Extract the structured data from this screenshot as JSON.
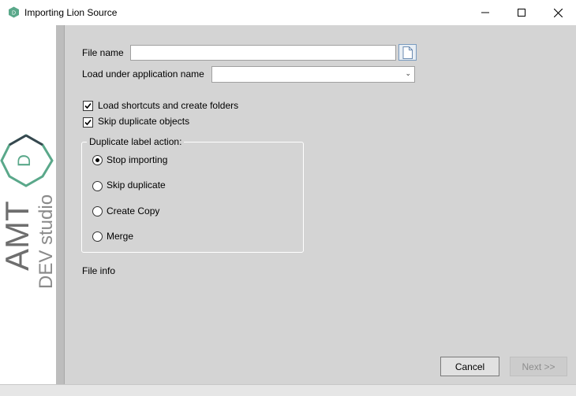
{
  "window": {
    "title": "Importing Lion Source"
  },
  "brand": {
    "logo_text": "AMT",
    "logo_subtext": "DEV studio",
    "logo_letter": "D",
    "accent": "#5aa88a"
  },
  "form": {
    "file_name_label": "File name",
    "file_name_value": "",
    "app_name_label": "Load under application name",
    "app_name_value": "",
    "load_shortcuts_label": "Load shortcuts and create folders",
    "load_shortcuts_checked": true,
    "skip_duplicates_label": "Skip duplicate objects",
    "skip_duplicates_checked": true
  },
  "duplicate_action": {
    "title": "Duplicate label action:",
    "options": [
      {
        "label": "Stop importing",
        "selected": true
      },
      {
        "label": "Skip duplicate",
        "selected": false
      },
      {
        "label": "Create Copy",
        "selected": false
      },
      {
        "label": "Merge",
        "selected": false
      }
    ]
  },
  "file_info_label": "File info",
  "buttons": {
    "cancel": "Cancel",
    "next": "Next >>"
  }
}
